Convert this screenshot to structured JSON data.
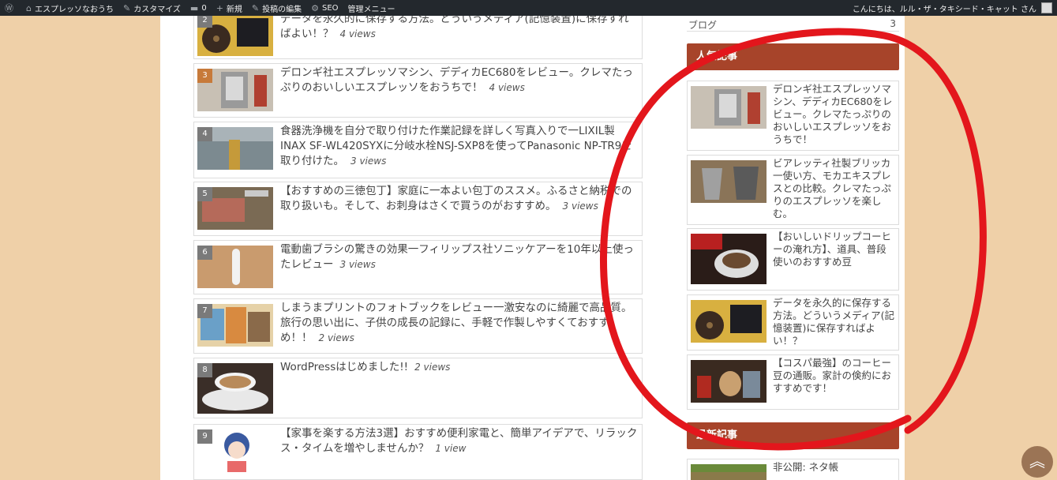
{
  "adminbar": {
    "site_name": "エスプレッソなおうち",
    "customize": "カスタマイズ",
    "comments": "0",
    "new": "新規",
    "edit_post": "投稿の編集",
    "seo": "SEO",
    "admin_menu": "管理メニュー",
    "greeting": "こんにちは、ルル・ザ・タキシード・キャット さん"
  },
  "ranking": [
    {
      "num": "2",
      "title": "データを永久的に保存する方法。どういうメディア(記憶装置)に保存すればよい！？",
      "views": "4 views"
    },
    {
      "num": "3",
      "title": "デロンギ社エスプレッソマシン、デディカEC680をレビュー。クレマたっぷりのおいしいエスプレッソをおうちで！",
      "views": "4 views"
    },
    {
      "num": "4",
      "title": "食器洗浄機を自分で取り付けた作業記録を詳しく写真入りで一LIXIL製INAX SF-WL420SYXに分岐水栓NSJ-SXP8を使ってPanasonic NP-TR9を取り付けた。",
      "views": "3 views"
    },
    {
      "num": "5",
      "title": "【おすすめの三徳包丁】家庭に一本よい包丁のススメ。ふるさと納税での取り扱いも。そして、お刺身はさくで買うのがおすすめ。",
      "views": "3 views"
    },
    {
      "num": "6",
      "title": "電動歯ブラシの驚きの効果一フィリップス社ソニッケアーを10年以上使ったレビュー",
      "views": "3 views"
    },
    {
      "num": "7",
      "title": "しまうまプリントのフォトブックをレビュー一激安なのに綺麗で高品質。旅行の思い出に、子供の成長の記録に、手軽で作製しやすくておすすめ！！",
      "views": "2 views"
    },
    {
      "num": "8",
      "title": "WordPressはじめました!!",
      "views": "2 views"
    },
    {
      "num": "9",
      "title": "【家事を楽する方法3選】おすすめ便利家電と、簡単アイデアで、リラックス・タイムを増やしませんか？",
      "views": "1 view"
    }
  ],
  "sidebar": {
    "top_label": "ブログ",
    "top_count": "3",
    "popular_title": "人気記事",
    "popular": [
      {
        "title": "デロンギ社エスプレッソマシン、デディカEC680をレビュー。クレマたっぷりのおいしいエスプレッソをおうちで！"
      },
      {
        "title": "ビアレッティ社製ブリッカ一使い方、モカエキスプレスとの比較。クレマたっぷりのエスプレッソを楽しむ。"
      },
      {
        "title": "【おいしいドリップコーヒーの淹れ方】、道具、普段使いのおすすめ豆"
      },
      {
        "title": "データを永久的に保存する方法。どういうメディア(記憶装置)に保存すればよい！？"
      },
      {
        "title": "【コスパ最強】のコーヒー豆の通販。家計の倹約におすすめです！"
      }
    ],
    "recent_title": "最新記事",
    "recent_first": "非公開: ネタ帳"
  },
  "colors": {
    "accent": "#a7442a",
    "background": "#efd0a8",
    "annotation": "#e3161c"
  }
}
